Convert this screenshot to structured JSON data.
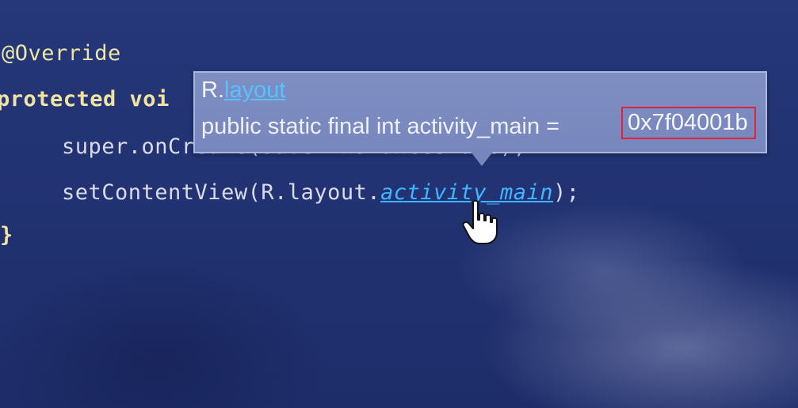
{
  "editor": {
    "line1": "@Override",
    "line2": "protected voi",
    "line3_prefix": "super.",
    "line3_method": "onCreate(savedInstanceState);",
    "line4_call": "setContentView(R.layout.",
    "line4_link": "activity_main",
    "line4_suffix": ");",
    "line5": "}"
  },
  "tooltip": {
    "class_prefix": "R.",
    "class_link": "layout",
    "declaration": "public static final int activity_main = ",
    "value": "0x7f04001b"
  },
  "colors": {
    "background": "#22336f",
    "tooltip_bg": "#7787bd",
    "link": "#3fb6ff",
    "highlight_border": "#e0233a"
  },
  "icons": {
    "cursor": "hand-pointer-icon",
    "arrow": "tooltip-arrow"
  }
}
